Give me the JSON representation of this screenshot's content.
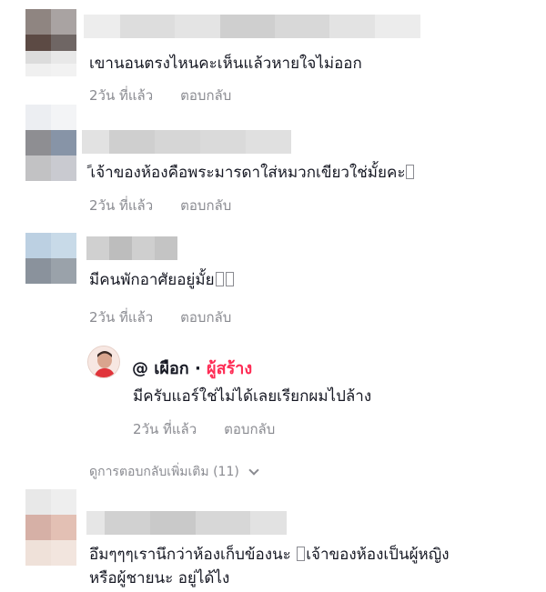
{
  "comments": [
    {
      "text": "เขานอนตรงไหนคะเห็นแล้วหายใจไม่ออก",
      "time": "2วัน ที่แล้ว",
      "reply_label": "ตอบกลับ"
    },
    {
      "text": "ً เจ้าของห้องคือพระมารดาใส่หมวกเขียวใช่มั้ยคะ",
      "time": "2วัน ที่แล้ว",
      "reply_label": "ตอบกลับ"
    },
    {
      "text": "มีคนพักอาศัยอยู่มั้ย",
      "time": "2วัน ที่แล้ว",
      "reply_label": "ตอบกลับ"
    },
    {
      "text_line1": "อึมๆๆๆเรานึกว่าห้องเก็บข้องนะ ",
      "text_line1b": "เจ้าของห้องเป็นผู้หญิง",
      "text_line2": "หรือผู้ชายนะ อยู่ได้ไง"
    }
  ],
  "creator_reply": {
    "name": "@ เผือก · ",
    "badge": "ผู้สร้าง",
    "text": "มีครับแอร์ใช่ไม่ได้เลยเรียกผมไปล้าง",
    "time": "2วัน ที่แล้ว",
    "reply_label": "ตอบกลับ"
  },
  "more_replies": {
    "label": "ดูการตอบกลับเพิ่มเติม (11)"
  },
  "colors": {
    "text": "#161823",
    "muted": "#8a8b91",
    "creator": "#fe2c55"
  }
}
